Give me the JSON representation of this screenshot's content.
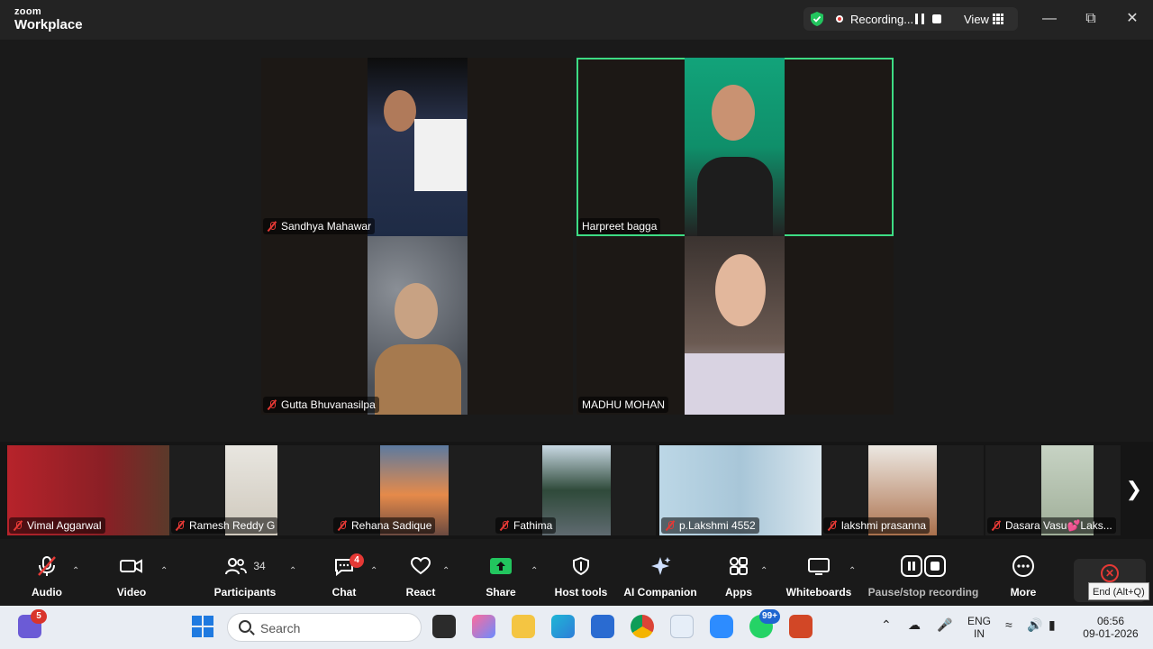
{
  "titlebar": {
    "logo_line1": "zoom",
    "logo_line2": "Workplace",
    "recording_label": "Recording...",
    "view_label": "View"
  },
  "gallery": [
    {
      "name": "Sandhya Mahawar",
      "muted": true
    },
    {
      "name": "Harpreet bagga",
      "muted": false,
      "active": true
    },
    {
      "name": "Gutta Bhuvanasilpa",
      "muted": true
    },
    {
      "name": "MADHU MOHAN",
      "muted": false
    }
  ],
  "strip": [
    {
      "name": "Vimal Aggarwal"
    },
    {
      "name": "Ramesh Reddy G"
    },
    {
      "name": "Rehana Sadique"
    },
    {
      "name": "Fathima"
    },
    {
      "name": "p.Lakshmi 4552"
    },
    {
      "name": "lakshmi prasanna"
    },
    {
      "name": "Dasara Vasu💕Laks..."
    }
  ],
  "toolbar": {
    "audio": "Audio",
    "video": "Video",
    "participants": "Participants",
    "participants_count": "34",
    "chat": "Chat",
    "chat_badge": "4",
    "react": "React",
    "share": "Share",
    "host_tools": "Host tools",
    "ai_companion": "AI Companion",
    "apps": "Apps",
    "whiteboards": "Whiteboards",
    "pause_stop": "Pause/stop recording",
    "more": "More",
    "end_tooltip": "End (Alt+Q)"
  },
  "taskbar": {
    "teams_badge": "5",
    "search_placeholder": "Search",
    "whatsapp_badge": "99+",
    "lang_line1": "ENG",
    "lang_line2": "IN",
    "time": "06:56",
    "date": "09-01-2026"
  },
  "colors": {
    "active_speaker": "#3ddc84",
    "muted_red": "#e53935",
    "share_green": "#22c55e"
  }
}
